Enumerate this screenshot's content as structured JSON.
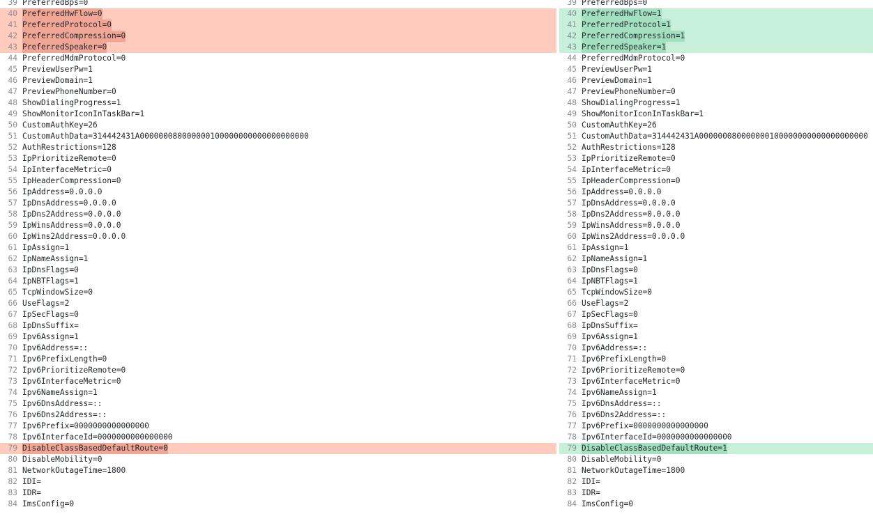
{
  "left_pane": {
    "lines": [
      {
        "num": "39",
        "text": "PreferredBps=0",
        "state": "normal"
      },
      {
        "num": "40",
        "text": "PreferredHwFlow=0",
        "state": "removed"
      },
      {
        "num": "41",
        "text": "PreferredProtocol=0",
        "state": "removed"
      },
      {
        "num": "42",
        "text": "PreferredCompression=0",
        "state": "removed"
      },
      {
        "num": "43",
        "text": "PreferredSpeaker=0",
        "state": "removed"
      },
      {
        "num": "44",
        "text": "PreferredMdmProtocol=0",
        "state": "normal"
      },
      {
        "num": "45",
        "text": "PreviewUserPw=1",
        "state": "normal"
      },
      {
        "num": "46",
        "text": "PreviewDomain=1",
        "state": "normal"
      },
      {
        "num": "47",
        "text": "PreviewPhoneNumber=0",
        "state": "normal"
      },
      {
        "num": "48",
        "text": "ShowDialingProgress=1",
        "state": "normal"
      },
      {
        "num": "49",
        "text": "ShowMonitorIconInTaskBar=1",
        "state": "normal"
      },
      {
        "num": "50",
        "text": "CustomAuthKey=26",
        "state": "normal"
      },
      {
        "num": "51",
        "text": "CustomAuthData=314442431A000000080000000100000000000000000000",
        "state": "normal"
      },
      {
        "num": "52",
        "text": "AuthRestrictions=128",
        "state": "normal"
      },
      {
        "num": "53",
        "text": "IpPrioritizeRemote=0",
        "state": "normal"
      },
      {
        "num": "54",
        "text": "IpInterfaceMetric=0",
        "state": "normal"
      },
      {
        "num": "55",
        "text": "IpHeaderCompression=0",
        "state": "normal"
      },
      {
        "num": "56",
        "text": "IpAddress=0.0.0.0",
        "state": "normal"
      },
      {
        "num": "57",
        "text": "IpDnsAddress=0.0.0.0",
        "state": "normal"
      },
      {
        "num": "58",
        "text": "IpDns2Address=0.0.0.0",
        "state": "normal"
      },
      {
        "num": "59",
        "text": "IpWinsAddress=0.0.0.0",
        "state": "normal"
      },
      {
        "num": "60",
        "text": "IpWins2Address=0.0.0.0",
        "state": "normal"
      },
      {
        "num": "61",
        "text": "IpAssign=1",
        "state": "normal"
      },
      {
        "num": "62",
        "text": "IpNameAssign=1",
        "state": "normal"
      },
      {
        "num": "63",
        "text": "IpDnsFlags=0",
        "state": "normal"
      },
      {
        "num": "64",
        "text": "IpNBTFlags=1",
        "state": "normal"
      },
      {
        "num": "65",
        "text": "TcpWindowSize=0",
        "state": "normal"
      },
      {
        "num": "66",
        "text": "UseFlags=2",
        "state": "normal"
      },
      {
        "num": "67",
        "text": "IpSecFlags=0",
        "state": "normal"
      },
      {
        "num": "68",
        "text": "IpDnsSuffix=",
        "state": "normal"
      },
      {
        "num": "69",
        "text": "Ipv6Assign=1",
        "state": "normal"
      },
      {
        "num": "70",
        "text": "Ipv6Address=::",
        "state": "normal"
      },
      {
        "num": "71",
        "text": "Ipv6PrefixLength=0",
        "state": "normal"
      },
      {
        "num": "72",
        "text": "Ipv6PrioritizeRemote=0",
        "state": "normal"
      },
      {
        "num": "73",
        "text": "Ipv6InterfaceMetric=0",
        "state": "normal"
      },
      {
        "num": "74",
        "text": "Ipv6NameAssign=1",
        "state": "normal"
      },
      {
        "num": "75",
        "text": "Ipv6DnsAddress=::",
        "state": "normal"
      },
      {
        "num": "76",
        "text": "Ipv6Dns2Address=::",
        "state": "normal"
      },
      {
        "num": "77",
        "text": "Ipv6Prefix=0000000000000000",
        "state": "normal"
      },
      {
        "num": "78",
        "text": "Ipv6InterfaceId=0000000000000000",
        "state": "normal"
      },
      {
        "num": "79",
        "text": "DisableClassBasedDefaultRoute=0",
        "state": "removed"
      },
      {
        "num": "80",
        "text": "DisableMobility=0",
        "state": "normal"
      },
      {
        "num": "81",
        "text": "NetworkOutageTime=1800",
        "state": "normal"
      },
      {
        "num": "82",
        "text": "IDI=",
        "state": "normal"
      },
      {
        "num": "83",
        "text": "IDR=",
        "state": "normal"
      },
      {
        "num": "84",
        "text": "ImsConfig=0",
        "state": "normal"
      }
    ]
  },
  "right_pane": {
    "lines": [
      {
        "num": "39",
        "text": "PreferredBps=0",
        "state": "normal"
      },
      {
        "num": "40",
        "text": "PreferredHwFlow=1",
        "state": "added"
      },
      {
        "num": "41",
        "text": "PreferredProtocol=1",
        "state": "added"
      },
      {
        "num": "42",
        "text": "PreferredCompression=1",
        "state": "added"
      },
      {
        "num": "43",
        "text": "PreferredSpeaker=1",
        "state": "added"
      },
      {
        "num": "44",
        "text": "PreferredMdmProtocol=0",
        "state": "normal"
      },
      {
        "num": "45",
        "text": "PreviewUserPw=1",
        "state": "normal"
      },
      {
        "num": "46",
        "text": "PreviewDomain=1",
        "state": "normal"
      },
      {
        "num": "47",
        "text": "PreviewPhoneNumber=0",
        "state": "normal"
      },
      {
        "num": "48",
        "text": "ShowDialingProgress=1",
        "state": "normal"
      },
      {
        "num": "49",
        "text": "ShowMonitorIconInTaskBar=1",
        "state": "normal"
      },
      {
        "num": "50",
        "text": "CustomAuthKey=26",
        "state": "normal"
      },
      {
        "num": "51",
        "text": "CustomAuthData=314442431A000000080000000100000000000000000000",
        "state": "normal"
      },
      {
        "num": "52",
        "text": "AuthRestrictions=128",
        "state": "normal"
      },
      {
        "num": "53",
        "text": "IpPrioritizeRemote=0",
        "state": "normal"
      },
      {
        "num": "54",
        "text": "IpInterfaceMetric=0",
        "state": "normal"
      },
      {
        "num": "55",
        "text": "IpHeaderCompression=0",
        "state": "normal"
      },
      {
        "num": "56",
        "text": "IpAddress=0.0.0.0",
        "state": "normal"
      },
      {
        "num": "57",
        "text": "IpDnsAddress=0.0.0.0",
        "state": "normal"
      },
      {
        "num": "58",
        "text": "IpDns2Address=0.0.0.0",
        "state": "normal"
      },
      {
        "num": "59",
        "text": "IpWinsAddress=0.0.0.0",
        "state": "normal"
      },
      {
        "num": "60",
        "text": "IpWins2Address=0.0.0.0",
        "state": "normal"
      },
      {
        "num": "61",
        "text": "IpAssign=1",
        "state": "normal"
      },
      {
        "num": "62",
        "text": "IpNameAssign=1",
        "state": "normal"
      },
      {
        "num": "63",
        "text": "IpDnsFlags=0",
        "state": "normal"
      },
      {
        "num": "64",
        "text": "IpNBTFlags=1",
        "state": "normal"
      },
      {
        "num": "65",
        "text": "TcpWindowSize=0",
        "state": "normal"
      },
      {
        "num": "66",
        "text": "UseFlags=2",
        "state": "normal"
      },
      {
        "num": "67",
        "text": "IpSecFlags=0",
        "state": "normal"
      },
      {
        "num": "68",
        "text": "IpDnsSuffix=",
        "state": "normal"
      },
      {
        "num": "69",
        "text": "Ipv6Assign=1",
        "state": "normal"
      },
      {
        "num": "70",
        "text": "Ipv6Address=::",
        "state": "normal"
      },
      {
        "num": "71",
        "text": "Ipv6PrefixLength=0",
        "state": "normal"
      },
      {
        "num": "72",
        "text": "Ipv6PrioritizeRemote=0",
        "state": "normal"
      },
      {
        "num": "73",
        "text": "Ipv6InterfaceMetric=0",
        "state": "normal"
      },
      {
        "num": "74",
        "text": "Ipv6NameAssign=1",
        "state": "normal"
      },
      {
        "num": "75",
        "text": "Ipv6DnsAddress=::",
        "state": "normal"
      },
      {
        "num": "76",
        "text": "Ipv6Dns2Address=::",
        "state": "normal"
      },
      {
        "num": "77",
        "text": "Ipv6Prefix=0000000000000000",
        "state": "normal"
      },
      {
        "num": "78",
        "text": "Ipv6InterfaceId=0000000000000000",
        "state": "normal"
      },
      {
        "num": "79",
        "text": "DisableClassBasedDefaultRoute=1",
        "state": "added"
      },
      {
        "num": "80",
        "text": "DisableMobility=0",
        "state": "normal"
      },
      {
        "num": "81",
        "text": "NetworkOutageTime=1800",
        "state": "normal"
      },
      {
        "num": "82",
        "text": "IDI=",
        "state": "normal"
      },
      {
        "num": "83",
        "text": "IDR=",
        "state": "normal"
      },
      {
        "num": "84",
        "text": "ImsConfig=0",
        "state": "normal"
      }
    ]
  }
}
